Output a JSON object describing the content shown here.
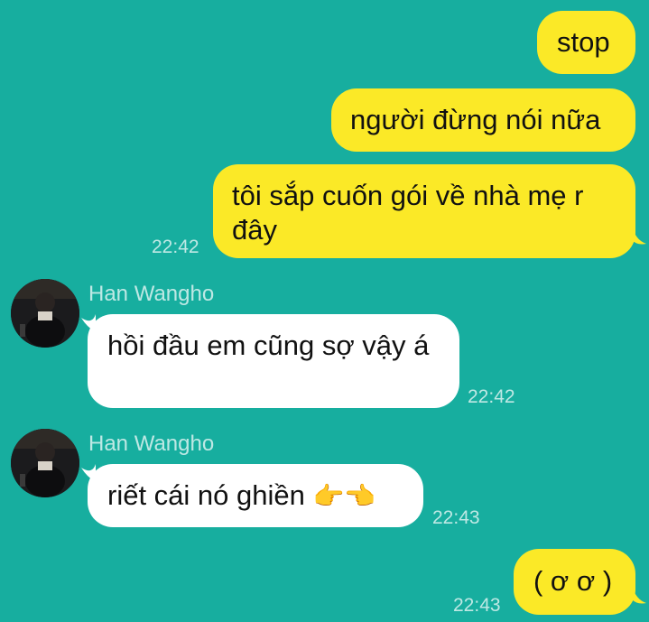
{
  "messages": [
    {
      "sender": "me",
      "text": "stop"
    },
    {
      "sender": "me",
      "text": "người đừng nói nữa"
    },
    {
      "sender": "me",
      "text": "tôi sắp cuốn gói về nhà mẹ r đây",
      "time": "22:42"
    },
    {
      "sender": "Han Wangho",
      "text": "hồi đầu em cũng sợ vậy á",
      "time": "22:42"
    },
    {
      "sender": "Han Wangho",
      "text": "riết cái nó ghiền",
      "emoji": "👉👈",
      "time": "22:43"
    },
    {
      "sender": "me",
      "text": "( ơ ơ )",
      "time": "22:43"
    }
  ],
  "colors": {
    "background": "#17ae9f",
    "outgoing_bubble": "#fbe927",
    "incoming_bubble": "#ffffff"
  }
}
